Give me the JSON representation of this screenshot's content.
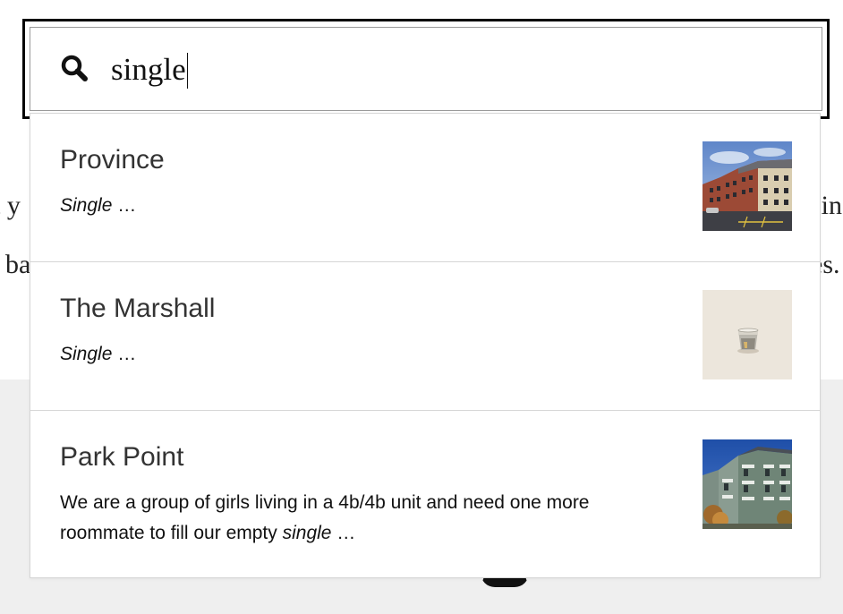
{
  "search": {
    "value": "single"
  },
  "background": {
    "line1_left": "t y",
    "line2_left": "ba",
    "line1_right": "sin",
    "line2_right": "es."
  },
  "results": [
    {
      "title": "Province",
      "snippet_before": "",
      "snippet_highlight": "Single",
      "snippet_after": " …",
      "thumbnail": "brick-apartment-building-photo"
    },
    {
      "title": "The Marshall",
      "snippet_before": "",
      "snippet_highlight": "Single",
      "snippet_after": " …",
      "thumbnail": "cup-on-beige-photo"
    },
    {
      "title": "Park Point",
      "snippet_before": "We are a group of girls living in a 4b/4b unit and need one more roommate to fill our empty ",
      "snippet_highlight": "single",
      "snippet_after": " …",
      "thumbnail": "green-apartment-building-photo"
    }
  ]
}
